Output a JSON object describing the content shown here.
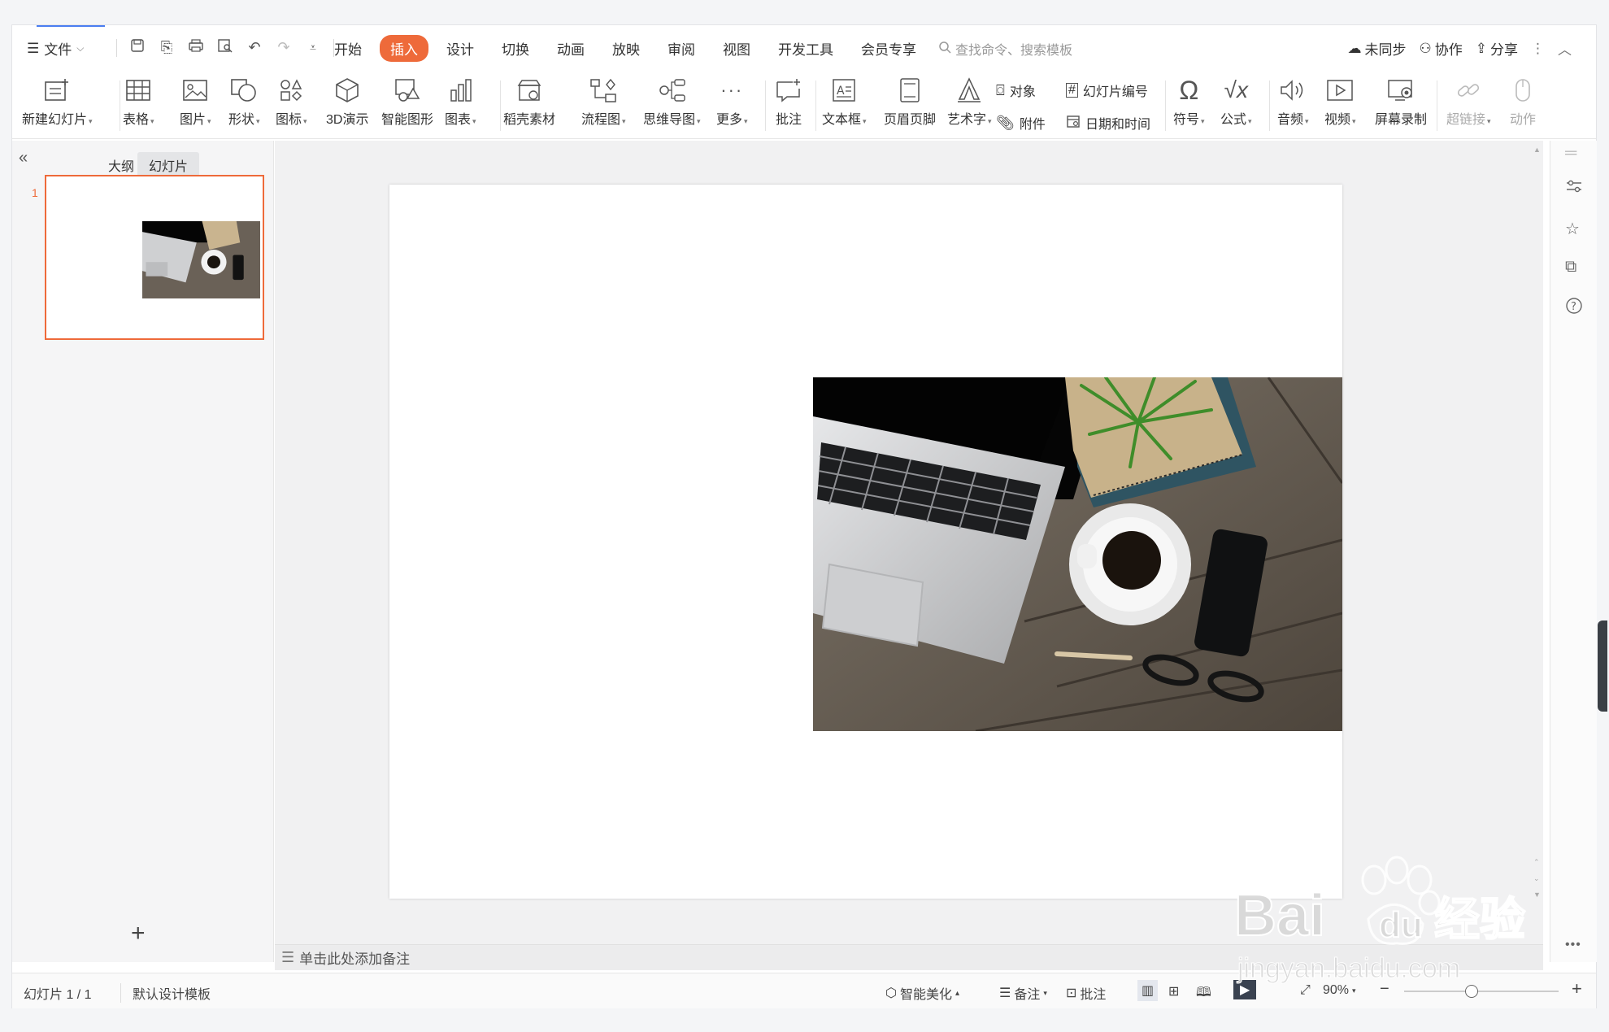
{
  "menu": {
    "file_label": "文件",
    "tabs": [
      "开始",
      "插入",
      "设计",
      "切换",
      "动画",
      "放映",
      "审阅",
      "视图",
      "开发工具",
      "会员专享"
    ],
    "active_tab": "插入",
    "search_placeholder": "查找命令、搜索模板",
    "sync_label": "未同步",
    "collab_label": "协作",
    "share_label": "分享"
  },
  "ribbon": {
    "new_slide": "新建幻灯片",
    "table": "表格",
    "picture": "图片",
    "shape": "形状",
    "icon": "图标",
    "demo3d": "3D演示",
    "smartart": "智能图形",
    "chart": "图表",
    "material": "稻壳素材",
    "flowchart": "流程图",
    "mindmap": "思维导图",
    "more": "更多",
    "comment": "批注",
    "textbox": "文本框",
    "header_footer": "页眉页脚",
    "wordart": "艺术字",
    "object": "对象",
    "slide_number": "幻灯片编号",
    "attachment": "附件",
    "datetime": "日期和时间",
    "symbol": "符号",
    "formula": "公式",
    "audio": "音频",
    "video": "视频",
    "screen_record": "屏幕录制",
    "hyperlink": "超链接",
    "action": "动作"
  },
  "left_panel": {
    "tab_outline": "大纲",
    "tab_slides": "幻灯片",
    "slide_number": "1"
  },
  "notes_placeholder": "单击此处添加备注",
  "status": {
    "slide_info": "幻灯片 1 / 1",
    "template": "默认设计模板",
    "beautify": "智能美化",
    "notes": "备注",
    "comment": "批注",
    "zoom": "90%"
  },
  "watermark": {
    "brand": "Bai",
    "brand2": "du",
    "cn": "经验",
    "url": "jingyan.baidu.com"
  },
  "colors": {
    "accent": "#ee6a3a",
    "blue": "#4a7df0"
  }
}
